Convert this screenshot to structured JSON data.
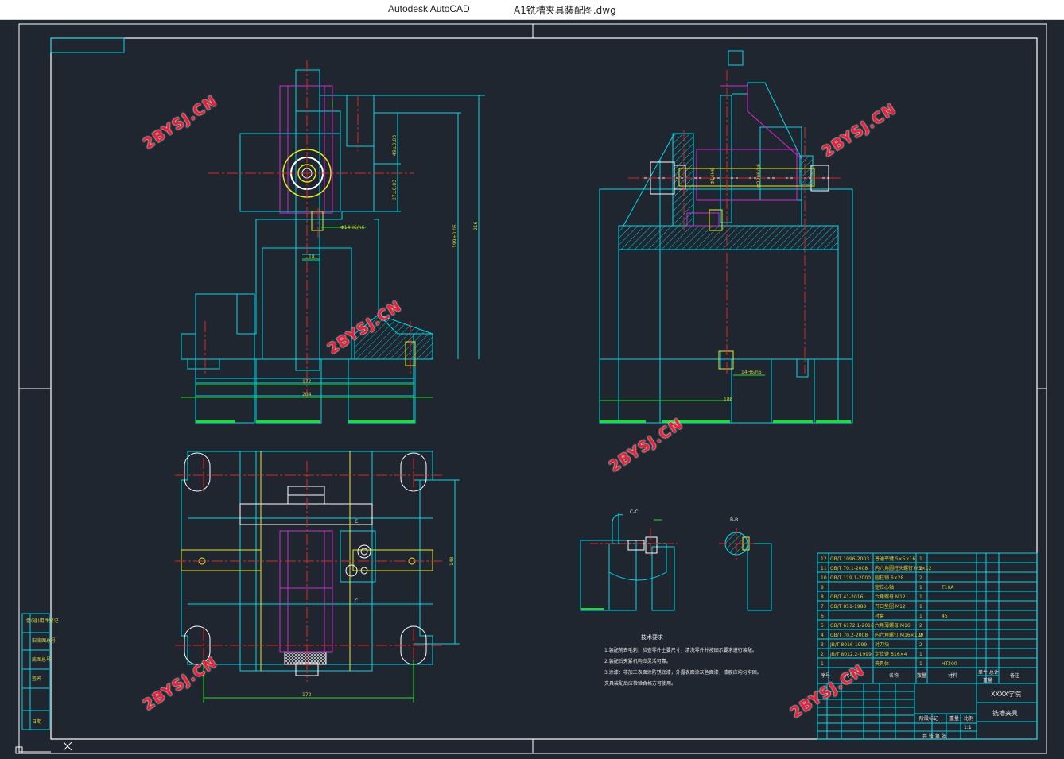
{
  "window": {
    "app_name": "Autodesk AutoCAD",
    "file_name": "A1铣槽夹具装配图.dwg"
  },
  "watermark": "2BYSJ.CN",
  "dimensions": {
    "d172_top": "172",
    "d204": "204",
    "d18": "18",
    "d199": "199±0.05",
    "d216": "216",
    "d49": "49±0.03",
    "d27": "27±0.03",
    "fit_top": "Φ14H6/h6",
    "fit_side": "14H6/h6",
    "d188": "188",
    "d148": "148",
    "d172_bottom": "172",
    "fit_vert_1": "Φ14H6",
    "fit_vert_2": "Φ22H6/k6"
  },
  "section_labels": {
    "cc": "C-C",
    "bb": "B-B",
    "c_mark_top": "C",
    "c_mark_bottom": "C"
  },
  "tech_notes": {
    "title": "技术要求",
    "lines": [
      "1.装配前去毛刺，检查零件主要尺寸，清洗零件并按图示要求进行装配。",
      "2.装配后夹紧机构应灵活可靠。",
      "3.涂漆：非加工表面涂防锈底漆，外露表面涂灰色面漆，漆膜应均匀牢固。",
      "   夹具装配后应检验合格方可使用。"
    ]
  },
  "bom": [
    {
      "no": "12",
      "code": "GB/T 1096-2003",
      "name": "普通平键 5×5×16",
      "qty": "1",
      "mat": ""
    },
    {
      "no": "11",
      "code": "GB/T 70.1-2008",
      "name": "内六角圆柱头螺钉 M5×12",
      "qty": "2",
      "mat": ""
    },
    {
      "no": "10",
      "code": "GB/T 119.1-2000",
      "name": "圆柱销 6×28",
      "qty": "2",
      "mat": ""
    },
    {
      "no": "9",
      "code": "",
      "name": "定位心轴",
      "qty": "1",
      "mat": "T10A"
    },
    {
      "no": "8",
      "code": "GB/T 41-2016",
      "name": "六角螺母 M12",
      "qty": "1",
      "mat": ""
    },
    {
      "no": "7",
      "code": "GB/T 851-1988",
      "name": "开口垫圈 M12",
      "qty": "1",
      "mat": ""
    },
    {
      "no": "6",
      "code": "",
      "name": "衬套",
      "qty": "1",
      "mat": "45"
    },
    {
      "no": "5",
      "code": "GB/T 6172.1-2016",
      "name": "六角薄螺母 M16",
      "qty": "2",
      "mat": ""
    },
    {
      "no": "4",
      "code": "GB/T 70.2-2008",
      "name": "内六角螺钉 M16×100",
      "qty": "2",
      "mat": ""
    },
    {
      "no": "3",
      "code": "JB/T 8016-1999",
      "name": "对刀块",
      "qty": "2",
      "mat": ""
    },
    {
      "no": "2",
      "code": "JB/T 8012.2-1999",
      "name": "定位键 B16×4",
      "qty": "1",
      "mat": ""
    },
    {
      "no": "1",
      "code": "",
      "name": "夹具体",
      "qty": "1",
      "mat": "HT200"
    }
  ],
  "bom_header": {
    "no": "序号",
    "code": "代号",
    "name": "名称",
    "qty": "数量",
    "mat": "材料",
    "weight": "单件 总计",
    "weight_unit": "重量",
    "remark": "备注"
  },
  "title_block": {
    "company": "XXXX学院",
    "drawing_name": "铣槽夹具",
    "stage": "阶段标记",
    "weight": "重量",
    "scale": "比例",
    "scale_value": "1:1",
    "sheet": "共 张  第 张"
  },
  "left_strip": {
    "items": [
      "借(通)用件登记",
      "旧底图总号",
      "底图总号",
      "签名",
      "日期"
    ]
  },
  "colors": {
    "background": "#1f2630",
    "frame": "#ffffff",
    "outline": "#00d7e6",
    "center": "#e82020",
    "magenta": "#d428d4",
    "yellow": "#e8e820",
    "green": "#22dd22"
  }
}
